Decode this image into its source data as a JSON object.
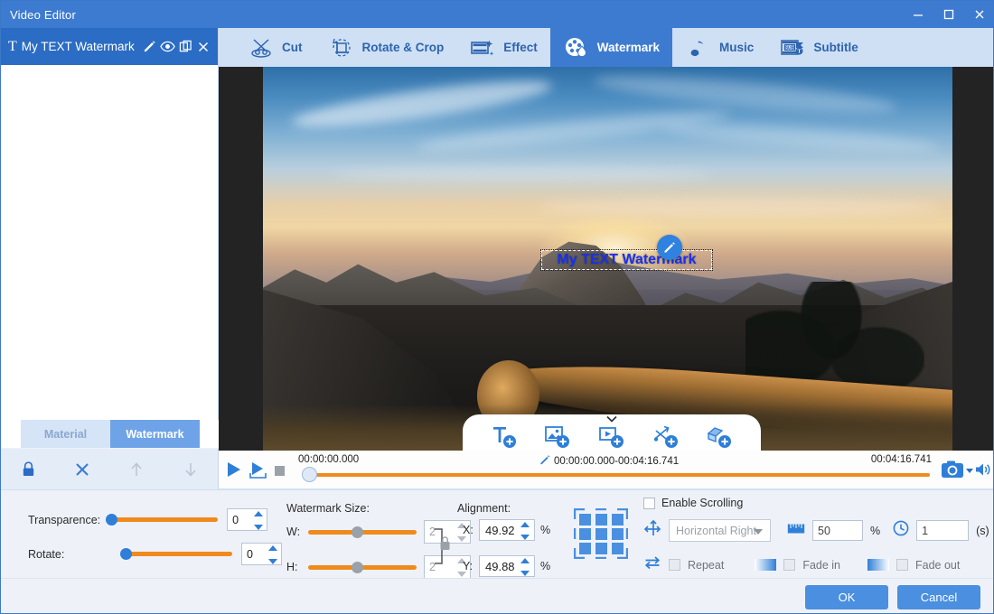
{
  "window": {
    "title": "Video Editor",
    "minimize": "–",
    "maximize": "□",
    "close": "✕"
  },
  "left_panel": {
    "watermark_item": {
      "type_glyph": "T",
      "label": "My TEXT Watermark",
      "edit_icon": "pencil-icon",
      "visibility_icon": "eye-icon",
      "duplicate_icon": "copy-icon",
      "close_icon": "close-icon"
    },
    "tabs": [
      {
        "label": "Material",
        "active": false
      },
      {
        "label": "Watermark",
        "active": true
      }
    ],
    "tools": [
      {
        "name": "lock-icon",
        "enabled": true
      },
      {
        "name": "delete-icon",
        "enabled": true
      },
      {
        "name": "move-up-icon",
        "enabled": false
      },
      {
        "name": "move-down-icon",
        "enabled": false
      }
    ]
  },
  "top_tabs": [
    {
      "label": "Cut",
      "icon": "scissors-icon",
      "active": false
    },
    {
      "label": "Rotate & Crop",
      "icon": "rotate-crop-icon",
      "active": false
    },
    {
      "label": "Effect",
      "icon": "effect-film-icon",
      "active": false
    },
    {
      "label": "Watermark",
      "icon": "watermark-film-drop-icon",
      "active": true
    },
    {
      "label": "Music",
      "icon": "music-note-icon",
      "active": false
    },
    {
      "label": "Subtitle",
      "icon": "subtitle-icon",
      "active": false
    }
  ],
  "preview": {
    "watermark_text": "My TEXT Watermark",
    "watermark_color": "#1830ee",
    "edit_button_icon": "pencil-icon",
    "add_toolbar": {
      "collapse_icon": "chevron-down-icon",
      "items": [
        {
          "name": "add-text-icon"
        },
        {
          "name": "add-image-icon"
        },
        {
          "name": "add-video-icon"
        },
        {
          "name": "add-gif-icon"
        },
        {
          "name": "add-shape-icon"
        }
      ]
    }
  },
  "timeline": {
    "play_icon": "play-icon",
    "play_selection_icon": "play-selection-icon",
    "stop_icon": "stop-icon",
    "current_time": "00:00:00.000",
    "range_edit_icon": "pencil-icon",
    "range": "00:00:00.000-00:04:16.741",
    "total_time": "00:04:16.741",
    "snapshot_icon": "camera-icon",
    "snapshot_caret_icon": "caret-down-icon",
    "volume_icon": "volume-icon"
  },
  "settings": {
    "transparence": {
      "label": "Transparence:",
      "value": "0"
    },
    "rotate": {
      "label": "Rotate:",
      "value": "0"
    },
    "watermark_size": {
      "label": "Watermark Size:",
      "width": {
        "label": "W:",
        "value": "2"
      },
      "height": {
        "label": "H:",
        "value": "2"
      },
      "lock_icon": "lock-aspect-icon"
    },
    "alignment": {
      "label": "Alignment:",
      "x": {
        "label": "X:",
        "value": "49.92",
        "unit": "%"
      },
      "y": {
        "label": "Y:",
        "value": "49.88",
        "unit": "%"
      },
      "grid_icon": "alignment-grid-icon"
    },
    "scrolling": {
      "enable_label": "Enable Scrolling",
      "enable_checked": false,
      "direction_icon": "scroll-direction-icon",
      "direction_value": "Horizontal Right",
      "speed_icon": "ruler-icon",
      "speed_value": "50",
      "speed_unit": "%",
      "duration_icon": "clock-icon",
      "duration_value": "1",
      "duration_unit": "(s)",
      "repeat_icon": "repeat-icon",
      "repeat_label": "Repeat",
      "repeat_checked": false,
      "fade_in_label": "Fade in",
      "fade_in_checked": false,
      "fade_out_label": "Fade out",
      "fade_out_checked": false
    }
  },
  "footer": {
    "ok_label": "OK",
    "cancel_label": "Cancel"
  },
  "colors": {
    "accent": "#3d7bd1",
    "tabbar": "#cfe0f5",
    "slider": "#f08a1e",
    "panel": "#eef2f8"
  }
}
